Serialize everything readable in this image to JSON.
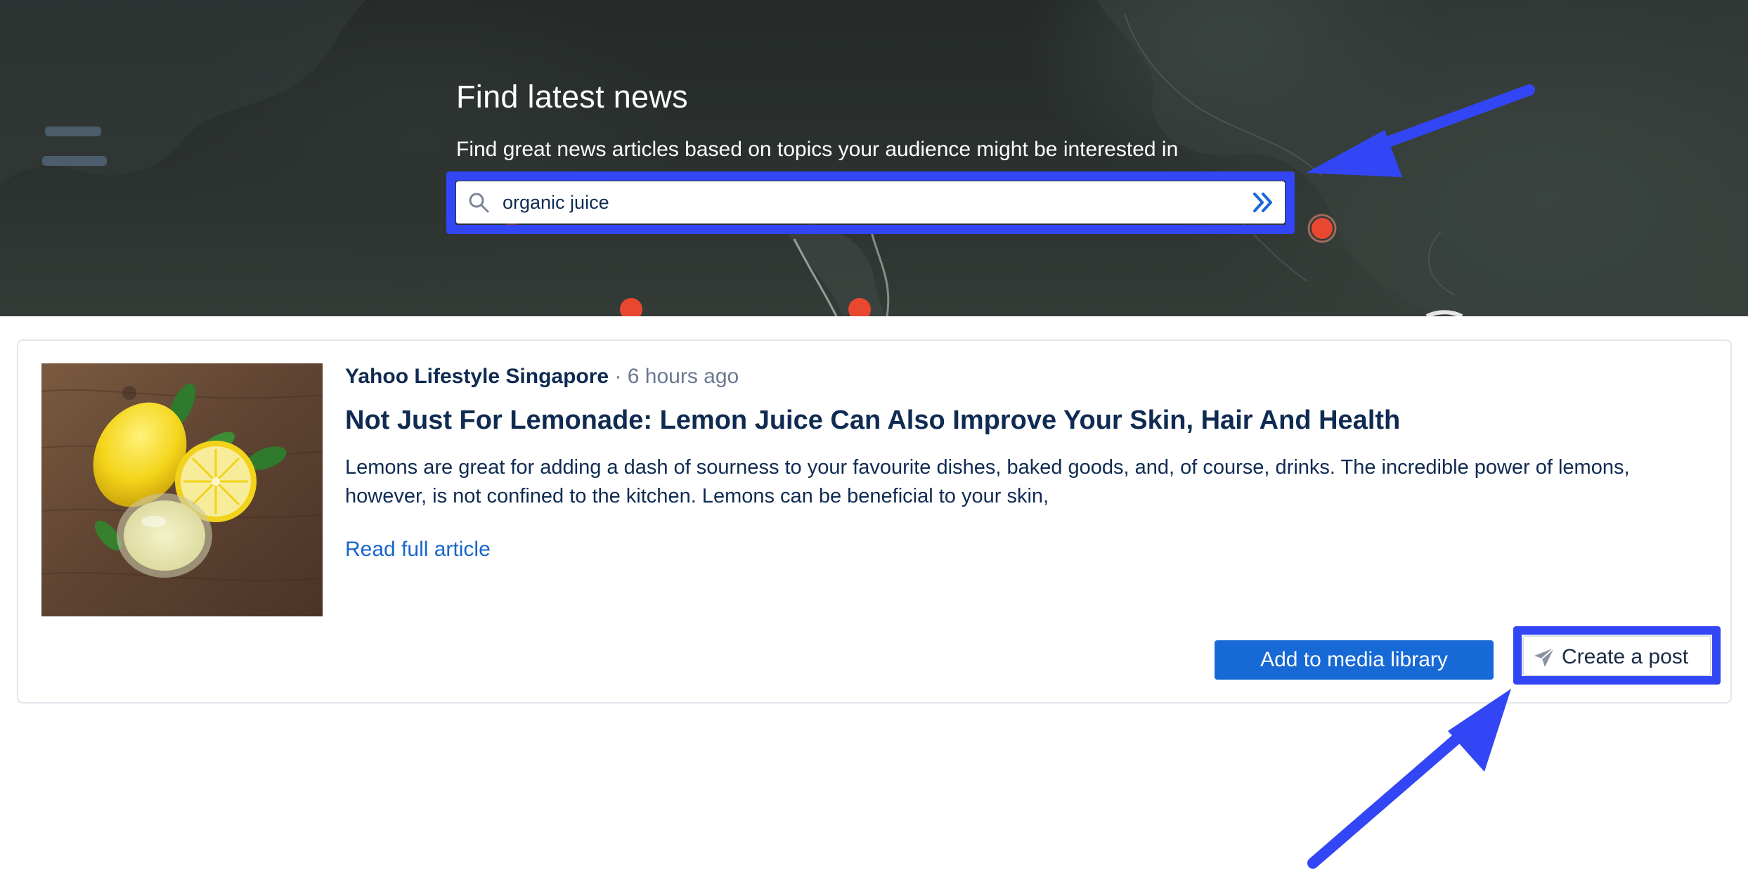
{
  "hero": {
    "title": "Find latest news",
    "subtitle": "Find great news articles based on topics your audience might be interested in"
  },
  "search": {
    "value": "organic juice",
    "icon": "search-icon",
    "submit_icon": "double-chevron-right-icon"
  },
  "article": {
    "source": "Yahoo Lifestyle Singapore",
    "separator": "·",
    "time": "6 hours ago",
    "headline": "Not Just For Lemonade: Lemon Juice Can Also Improve Your Skin, Hair And Health",
    "excerpt": "Lemons are great for adding a dash of sourness to your favourite dishes, baked goods, and, of course, drinks. The incredible power of lemons, however, is not confined to the kitchen. Lemons can be beneficial to your skin,",
    "read_more": "Read full article",
    "thumbnail": "lemons-and-lemon-juice-image"
  },
  "actions": {
    "add_media_label": "Add to media library",
    "create_post_label": "Create a post",
    "create_post_icon": "send-icon"
  },
  "colors": {
    "annotation_blue": "#3346f5",
    "primary_button": "#1769d6",
    "link": "#1766c9",
    "text_dark": "#0f2b52",
    "hero_bg": "#2b312e"
  }
}
